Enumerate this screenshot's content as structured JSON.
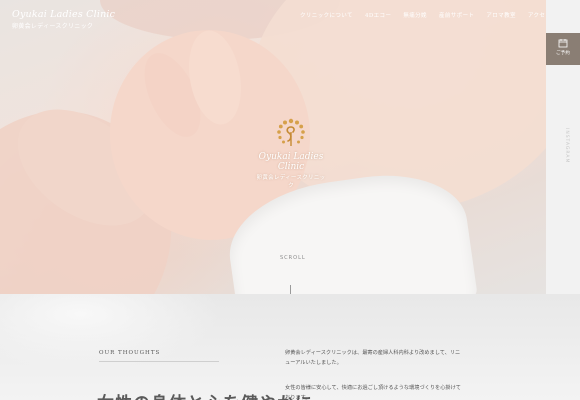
{
  "header": {
    "logo_en": "Oyukai Ladies Clinic",
    "logo_jp": "卵黄会レディースクリニック"
  },
  "nav": {
    "items": [
      {
        "label": "クリニックについて"
      },
      {
        "label": "4Dエコー"
      },
      {
        "label": "無痛分娩"
      },
      {
        "label": "産前サポート"
      },
      {
        "label": "アロマ教室"
      },
      {
        "label": "アクセス"
      }
    ]
  },
  "hero": {
    "center_logo_en": "Oyukai Ladies Clinic",
    "center_logo_jp": "卵黄会レディースクリニック",
    "scroll_label": "SCROLL"
  },
  "sidebar": {
    "tab_label": "ご予約",
    "tab_icon": "calendar-icon",
    "vertical_text": "INSTAGRAM"
  },
  "about": {
    "section_label": "OUR THOUGHTS",
    "headline": "女性の身体と心を健やかに",
    "paragraph_1": "卵黄会レディースクリニックは、最寄の産婦人科内科より改めまして、リニューアルいたしました。",
    "paragraph_2": "女性の皆様に安心して、快適にお過ごし頂けるような環境づくりを心掛けております。"
  },
  "colors": {
    "accent_gold": "#d6a04a",
    "sidebar_tab": "#8a7e74"
  }
}
